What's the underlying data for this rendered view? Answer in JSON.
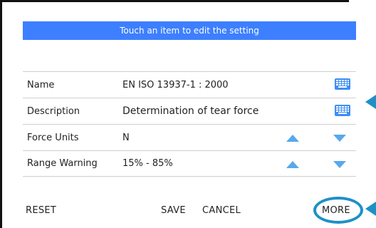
{
  "banner": {
    "text": "Touch an item to edit the setting"
  },
  "rows": [
    {
      "label": "Name",
      "value": "EN ISO 13937-1 : 2000",
      "control": "keyboard-icon"
    },
    {
      "label": "Description",
      "value": "Determination of tear force",
      "control": "keyboard-icon"
    },
    {
      "label": "Force Units",
      "value": "N",
      "control": "up-down-arrows"
    },
    {
      "label": "Range Warning",
      "value": "15% - 85%",
      "control": "up-down-arrows"
    }
  ],
  "footer": {
    "reset_label": "RESET",
    "save_label": "SAVE",
    "cancel_label": "CANCEL",
    "more_label": "MORE"
  },
  "colors": {
    "banner": "#3d7fff",
    "icon_blue": "#3d8ff5",
    "arrow_blue": "#58a8ec",
    "callout_blue": "#1e90c8"
  }
}
